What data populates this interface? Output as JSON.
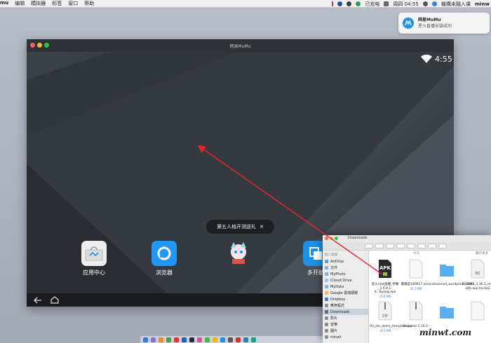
{
  "menubar": {
    "app_menu": "mu",
    "items": [
      "编辑",
      "模拟器",
      "标签",
      "窗口",
      "帮助"
    ],
    "status_charging": "已充电",
    "status_time": "周四 04:55",
    "status_user": "機構未融入课",
    "status_end": "minw"
  },
  "notification": {
    "title": "网易MuMu",
    "message": "星火直播安装成功"
  },
  "emulator": {
    "title": "网易MuMu",
    "clock": "4:55",
    "toast": "第五人格开测送礼",
    "toast_close": "✕",
    "apps": [
      {
        "label": "应用中心"
      },
      {
        "label": "浏览器"
      },
      {
        "label": ""
      },
      {
        "label": "多开助"
      }
    ],
    "colors": {
      "browser": "#2196f3",
      "accent": "#d9534f"
    }
  },
  "finder": {
    "title": "Downloads",
    "sidebar_header": "個人收藏",
    "sidebar": [
      "AirDrop",
      "文件",
      "MyPhoto",
      "iCloud Drive",
      "MyData",
      "Google 雲端硬碟",
      "Dropbox",
      "應用程式",
      "Downloads",
      "影片",
      "音樂",
      "圖片",
      "minwt"
    ],
    "main_header_left": "今天",
    "main_header_right": "顯示更多",
    "files": [
      {
        "name": "星火new直播_手機\n_1.9.8.1-0...8yong.apk",
        "size": "15.6 MB"
      },
      {
        "name": "鳳凰區180817.xlsm",
        "size": "41.1 MB"
      },
      {
        "name": "advanced_wordpress_5891",
        "size": ""
      },
      {
        "name": "FileZilla_3.36.2_macosx-x86.app.tar.bz2",
        "size": ""
      },
      {
        "name": "03_ele_demo_template.zip",
        "size": "18.3 MB"
      },
      {
        "name": "Snipaste-1.16.2-",
        "size": ""
      },
      {
        "name": "",
        "size": ""
      },
      {
        "name": "",
        "size": ""
      }
    ]
  },
  "watermark": "minwt.com"
}
